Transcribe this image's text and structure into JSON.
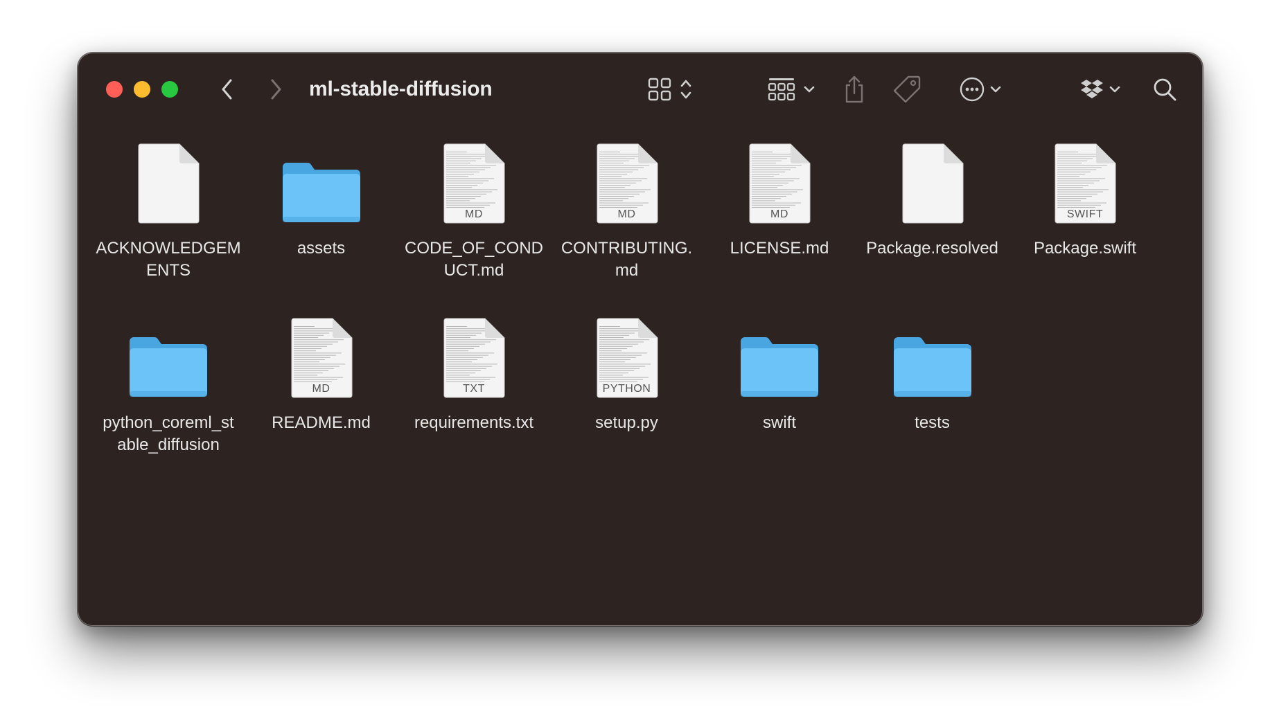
{
  "window": {
    "title": "ml-stable-diffusion"
  },
  "toolbar": {
    "back": "chevron-left-icon",
    "forward": "chevron-right-icon",
    "view_toggle": "icon-grid-view-icon",
    "group": "group-by-icon",
    "share": "share-icon",
    "tag": "tag-icon",
    "more": "more-actions-icon",
    "dropbox": "dropbox-icon",
    "search": "search-icon"
  },
  "colors": {
    "background": "#2d2321",
    "folder": "#6cc3f7",
    "folder_dark": "#4aa6e0",
    "text": "#e8e8e8",
    "close": "#ff5f57",
    "minimize": "#febc2e",
    "maximize": "#28c840"
  },
  "files": [
    {
      "name": "ACKNOWLEDGEMENTS",
      "display": "ACKNOWLEDGEM\nENTS",
      "kind": "document",
      "ext": "",
      "lines": false
    },
    {
      "name": "assets",
      "display": "assets",
      "kind": "folder"
    },
    {
      "name": "CODE_OF_CONDUCT.md",
      "display": "CODE_OF_COND\nUCT.md",
      "kind": "document",
      "ext": "MD",
      "lines": true
    },
    {
      "name": "CONTRIBUTING.md",
      "display": "CONTRIBUTING.\nmd",
      "kind": "document",
      "ext": "MD",
      "lines": true
    },
    {
      "name": "LICENSE.md",
      "display": "LICENSE.md",
      "kind": "document",
      "ext": "MD",
      "lines": true
    },
    {
      "name": "Package.resolved",
      "display": "Package.resolved",
      "kind": "document",
      "ext": "",
      "lines": false
    },
    {
      "name": "Package.swift",
      "display": "Package.swift",
      "kind": "document",
      "ext": "SWIFT",
      "lines": true
    },
    {
      "name": "python_coreml_stable_diffusion",
      "display": "python_coreml_st\nable_diffusion",
      "kind": "folder"
    },
    {
      "name": "README.md",
      "display": "README.md",
      "kind": "document",
      "ext": "MD",
      "lines": true
    },
    {
      "name": "requirements.txt",
      "display": "requirements.txt",
      "kind": "document",
      "ext": "TXT",
      "lines": true
    },
    {
      "name": "setup.py",
      "display": "setup.py",
      "kind": "document",
      "ext": "PYTHON",
      "lines": true
    },
    {
      "name": "swift",
      "display": "swift",
      "kind": "folder"
    },
    {
      "name": "tests",
      "display": "tests",
      "kind": "folder"
    }
  ]
}
